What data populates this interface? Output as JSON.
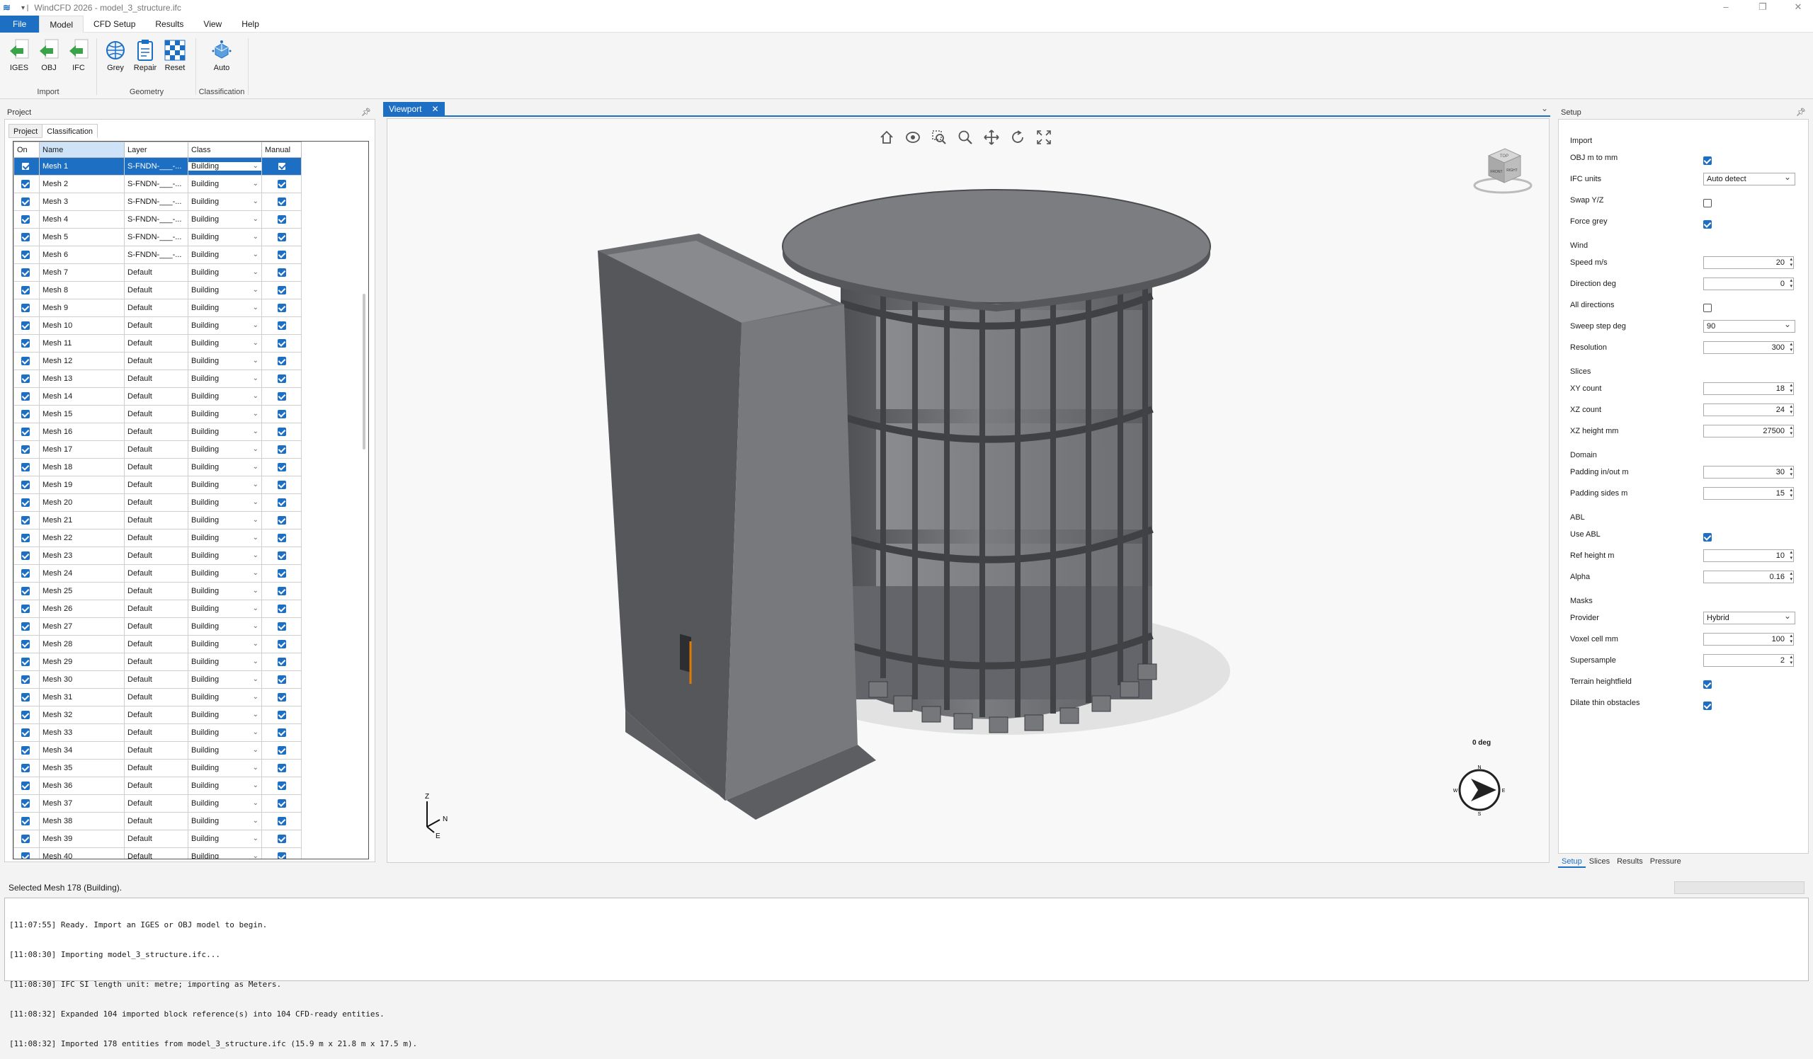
{
  "window": {
    "title": "WindCFD 2026 - model_3_structure.ifc",
    "quick_access": "▾ |"
  },
  "menu": [
    "File",
    "Model",
    "CFD Setup",
    "Results",
    "View",
    "Help"
  ],
  "ribbon": {
    "import": {
      "label": "Import",
      "buttons": [
        "IGES",
        "OBJ",
        "IFC"
      ]
    },
    "geometry": {
      "label": "Geometry",
      "buttons": [
        "Grey",
        "Repair",
        "Reset"
      ]
    },
    "classification": {
      "label": "Classification",
      "buttons": [
        "Auto"
      ]
    }
  },
  "project_panel": {
    "title": "Project",
    "pin_icon": "pin-icon",
    "tabs": [
      "Project",
      "Classification"
    ],
    "columns": [
      "On",
      "Name",
      "Layer",
      "Class",
      "Manual"
    ],
    "rows": [
      {
        "name": "Mesh 1",
        "layer": "S-FNDN-___-...",
        "class": "Building"
      },
      {
        "name": "Mesh 2",
        "layer": "S-FNDN-___-...",
        "class": "Building"
      },
      {
        "name": "Mesh 3",
        "layer": "S-FNDN-___-...",
        "class": "Building"
      },
      {
        "name": "Mesh 4",
        "layer": "S-FNDN-___-...",
        "class": "Building"
      },
      {
        "name": "Mesh 5",
        "layer": "S-FNDN-___-...",
        "class": "Building"
      },
      {
        "name": "Mesh 6",
        "layer": "S-FNDN-___-...",
        "class": "Building"
      },
      {
        "name": "Mesh 7",
        "layer": "Default",
        "class": "Building"
      },
      {
        "name": "Mesh 8",
        "layer": "Default",
        "class": "Building"
      },
      {
        "name": "Mesh 9",
        "layer": "Default",
        "class": "Building"
      },
      {
        "name": "Mesh 10",
        "layer": "Default",
        "class": "Building"
      },
      {
        "name": "Mesh 11",
        "layer": "Default",
        "class": "Building"
      },
      {
        "name": "Mesh 12",
        "layer": "Default",
        "class": "Building"
      },
      {
        "name": "Mesh 13",
        "layer": "Default",
        "class": "Building"
      },
      {
        "name": "Mesh 14",
        "layer": "Default",
        "class": "Building"
      },
      {
        "name": "Mesh 15",
        "layer": "Default",
        "class": "Building"
      },
      {
        "name": "Mesh 16",
        "layer": "Default",
        "class": "Building"
      },
      {
        "name": "Mesh 17",
        "layer": "Default",
        "class": "Building"
      },
      {
        "name": "Mesh 18",
        "layer": "Default",
        "class": "Building"
      },
      {
        "name": "Mesh 19",
        "layer": "Default",
        "class": "Building"
      },
      {
        "name": "Mesh 20",
        "layer": "Default",
        "class": "Building"
      },
      {
        "name": "Mesh 21",
        "layer": "Default",
        "class": "Building"
      },
      {
        "name": "Mesh 22",
        "layer": "Default",
        "class": "Building"
      },
      {
        "name": "Mesh 23",
        "layer": "Default",
        "class": "Building"
      },
      {
        "name": "Mesh 24",
        "layer": "Default",
        "class": "Building"
      },
      {
        "name": "Mesh 25",
        "layer": "Default",
        "class": "Building"
      },
      {
        "name": "Mesh 26",
        "layer": "Default",
        "class": "Building"
      },
      {
        "name": "Mesh 27",
        "layer": "Default",
        "class": "Building"
      },
      {
        "name": "Mesh 28",
        "layer": "Default",
        "class": "Building"
      },
      {
        "name": "Mesh 29",
        "layer": "Default",
        "class": "Building"
      },
      {
        "name": "Mesh 30",
        "layer": "Default",
        "class": "Building"
      },
      {
        "name": "Mesh 31",
        "layer": "Default",
        "class": "Building"
      },
      {
        "name": "Mesh 32",
        "layer": "Default",
        "class": "Building"
      },
      {
        "name": "Mesh 33",
        "layer": "Default",
        "class": "Building"
      },
      {
        "name": "Mesh 34",
        "layer": "Default",
        "class": "Building"
      },
      {
        "name": "Mesh 35",
        "layer": "Default",
        "class": "Building"
      },
      {
        "name": "Mesh 36",
        "layer": "Default",
        "class": "Building"
      },
      {
        "name": "Mesh 37",
        "layer": "Default",
        "class": "Building"
      },
      {
        "name": "Mesh 38",
        "layer": "Default",
        "class": "Building"
      },
      {
        "name": "Mesh 39",
        "layer": "Default",
        "class": "Building"
      },
      {
        "name": "Mesh 40",
        "layer": "Default",
        "class": "Building"
      }
    ]
  },
  "viewport": {
    "tab_label": "Viewport",
    "close_glyph": "✕",
    "overflow_glyph": "⌄",
    "toolbar_icons": [
      "home-icon",
      "orbit-icon",
      "zoom-window-icon",
      "zoom-icon",
      "pan-icon",
      "rotate-icon",
      "fit-screen-icon"
    ],
    "compass_label": "0 deg",
    "compass_letters": {
      "n": "N",
      "s": "S",
      "e": "E",
      "w": "W"
    },
    "axis_labels": {
      "z": "Z",
      "n": "N",
      "e": "E"
    },
    "viewcube_faces": {
      "top": "TOP",
      "front": "FRONT",
      "right": "RIGHT"
    }
  },
  "setup_panel": {
    "title": "Setup",
    "import": {
      "section": "Import",
      "obj_m_to_mm": {
        "label": "OBJ m to mm",
        "checked": true
      },
      "ifc_units": {
        "label": "IFC units",
        "value": "Auto detect"
      },
      "swap_yz": {
        "label": "Swap Y/Z",
        "checked": false
      },
      "force_grey": {
        "label": "Force grey",
        "checked": true
      }
    },
    "wind": {
      "section": "Wind",
      "speed": {
        "label": "Speed m/s",
        "value": "20"
      },
      "direction": {
        "label": "Direction deg",
        "value": "0"
      },
      "all_directions": {
        "label": "All directions",
        "checked": false
      },
      "sweep_step": {
        "label": "Sweep step deg",
        "value": "90"
      },
      "resolution": {
        "label": "Resolution",
        "value": "300"
      }
    },
    "slices": {
      "section": "Slices",
      "xy_count": {
        "label": "XY count",
        "value": "18"
      },
      "xz_count": {
        "label": "XZ count",
        "value": "24"
      },
      "xz_height": {
        "label": "XZ height mm",
        "value": "27500"
      }
    },
    "domain": {
      "section": "Domain",
      "padding_inout": {
        "label": "Padding in/out m",
        "value": "30"
      },
      "padding_sides": {
        "label": "Padding sides m",
        "value": "15"
      }
    },
    "abl": {
      "section": "ABL",
      "use_abl": {
        "label": "Use ABL",
        "checked": true
      },
      "ref_height": {
        "label": "Ref height m",
        "value": "10"
      },
      "alpha": {
        "label": "Alpha",
        "value": "0.16"
      }
    },
    "masks": {
      "section": "Masks",
      "provider": {
        "label": "Provider",
        "value": "Hybrid"
      },
      "voxel_cell": {
        "label": "Voxel cell mm",
        "value": "100"
      },
      "supersample": {
        "label": "Supersample",
        "value": "2"
      },
      "terrain_heightfield": {
        "label": "Terrain heightfield",
        "checked": true
      },
      "dilate_thin": {
        "label": "Dilate thin obstacles",
        "checked": true
      }
    },
    "bottom_tabs": [
      "Setup",
      "Slices",
      "Results",
      "Pressure"
    ]
  },
  "status": {
    "text": "Selected Mesh 178 (Building)."
  },
  "log": [
    "[11:07:55] Ready. Import an IGES or OBJ model to begin.",
    "[11:08:30] Importing model_3_structure.ifc...",
    "[11:08:30] IFC SI length unit: metre; importing as Meters.",
    "[11:08:32] Expanded 104 imported block reference(s) into 104 CFD-ready entities.",
    "[11:08:32] Imported 178 entities from model_3_structure.ifc (15.9 m x 21.8 m x 17.5 m)."
  ],
  "colors": {
    "accent": "#1d6fc4",
    "model_grey": "#6e7074",
    "highlight": "#e07b00"
  }
}
